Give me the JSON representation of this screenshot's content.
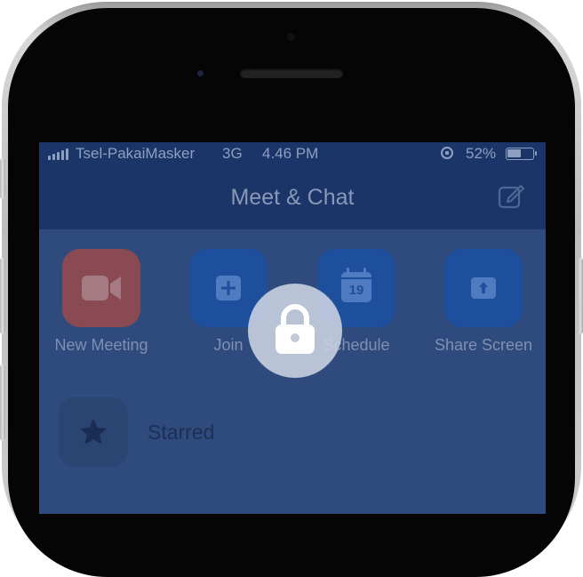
{
  "status_bar": {
    "carrier": "Tsel-PakaiMasker",
    "network": "3G",
    "time": "4.46 PM",
    "battery": "52%",
    "battery_level": 0.52
  },
  "header": {
    "title": "Meet & Chat",
    "edit_icon": "compose-icon"
  },
  "actions": [
    {
      "label": "New Meeting",
      "icon": "video-camera-icon",
      "color": "#8a4a53"
    },
    {
      "label": "Join",
      "icon": "plus-icon",
      "color": "#1e4f9d"
    },
    {
      "label": "Schedule",
      "icon": "calendar-icon",
      "calendar_day": "19",
      "color": "#1e4f9d"
    },
    {
      "label": "Share Screen",
      "icon": "share-up-arrow-icon",
      "color": "#1e4f9d"
    }
  ],
  "list": {
    "starred_label": "Starred",
    "starred_icon": "star-icon"
  },
  "overlay": {
    "icon": "lock-icon"
  },
  "colors": {
    "header": "#1b3568",
    "background": "#2f4a7c",
    "accent": "#1e4f9d"
  }
}
